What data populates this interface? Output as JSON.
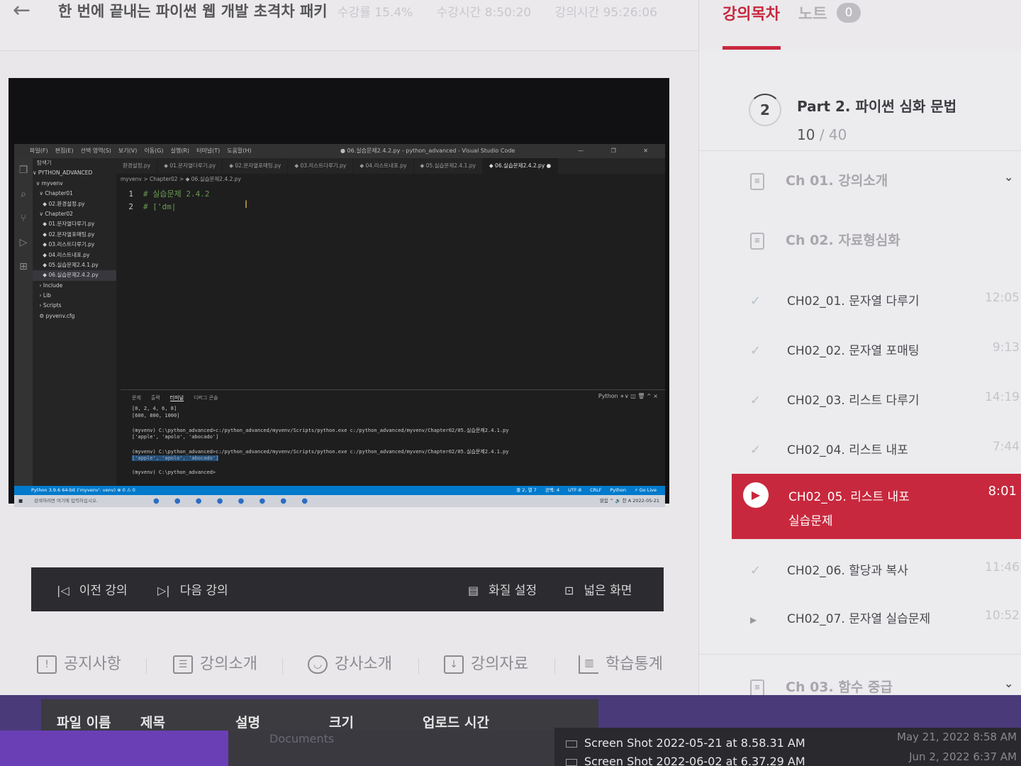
{
  "header": {
    "back_icon": "arrow-left-icon",
    "course_title": "한 번에 끝내는 파이썬 웹 개발 초격차 패키",
    "progress_label": "수강률 15.4%",
    "watched_time": "수강시간 8:50:20",
    "total_time": "강의시간 95:26:06"
  },
  "side_tabs": {
    "toc": "강의목차",
    "note": "노트",
    "note_count": "0"
  },
  "vscode": {
    "window_title": "● 06.실습문제2.4.2.py - python_advanced - Visual Studio Code",
    "menu": [
      "파일(F)",
      "편집(E)",
      "선택 영역(S)",
      "보기(V)",
      "이동(G)",
      "실행(R)",
      "터미널(T)",
      "도움말(H)"
    ],
    "explorer_header": "탐색기",
    "tree": [
      "∨ PYTHON_ADVANCED",
      "  ∨ myvenv",
      "    ∨ Chapter01",
      "      ◆ 02.환경설정.py",
      "    ∨ Chapter02",
      "      ◆ 01.문자열다루기.py",
      "      ◆ 02.문자열포매팅.py",
      "      ◆ 03.리스트다루기.py",
      "      ◆ 04.리스트내포.py",
      "      ◆ 05.실습문제2.4.1.py",
      "      ◆ 06.실습문제2.4.2.py",
      "    › Include",
      "    › Lib",
      "    › Scripts",
      "    ⚙ pyvenv.cfg"
    ],
    "selected_tree_index": 10,
    "tabs": [
      "환경설정.py",
      "◆ 01.문자열다루기.py",
      "◆ 02.문자열포매팅.py",
      "◆ 03.리스트다루기.py",
      "◆ 04.리스트내포.py",
      "◆ 05.실습문제2.4.1.py",
      "◆ 06.실습문제2.4.2.py ●"
    ],
    "active_tab_index": 6,
    "breadcrumb": "myvenv > Chapter02 > ◆ 06.실습문제2.4.2.py",
    "code": [
      {
        "num": "1",
        "text": "# 실습문제 2.4.2"
      },
      {
        "num": "2",
        "text": "# ['dm|"
      }
    ],
    "panel_tabs": [
      "문제",
      "출력",
      "터미널",
      "디버그 콘솔"
    ],
    "active_panel_tab": 2,
    "panel_tools": "Python  +∨  ◫  🗑  ^  ×",
    "terminal": [
      "[0, 2, 4, 6, 8]",
      "[600, 800, 1000]",
      "",
      "(myvenv) C:\\python_advanced>c:/python_advanced/myvenv/Scripts/python.exe c:/python_advanced/myvenv/Chapter02/05.실습문제2.4.1.py",
      "['apple', 'apolo', 'abocado']",
      "",
      "(myvenv) C:\\python_advanced>c:/python_advanced/myvenv/Scripts/python.exe c:/python_advanced/myvenv/Chapter02/05.실습문제2.4.1.py",
      "['apple', 'apolo', 'abocado']",
      "",
      "(myvenv) C:\\python_advanced>"
    ],
    "status_left": "Python 3.9.6 64-bit ('myvenv': venv)   ⊗ 0 ⚠ 0",
    "status_right": [
      "줄 2, 열 7",
      "공백: 4",
      "UTF-8",
      "CRLF",
      "Python",
      "⚡ Go Live"
    ],
    "taskbar_search": "검색하려면 여기에 입력하십시오.",
    "taskbar_tray": "맑음 ^ 🔊 한 A  2022-05-21"
  },
  "player": {
    "prev_icon": "skip-previous-icon",
    "prev_label": "이전 강의",
    "next_icon": "skip-next-icon",
    "next_label": "다음 강의",
    "quality_icon": "quality-icon",
    "quality_label": "화질 설정",
    "wide_icon": "wide-screen-icon",
    "wide_label": "넓은 화면"
  },
  "info_tabs": [
    {
      "label": "공지사항",
      "icon": "notice-icon"
    },
    {
      "label": "강의소개",
      "icon": "clipboard-icon"
    },
    {
      "label": "강사소개",
      "icon": "instructor-icon"
    },
    {
      "label": "강의자료",
      "icon": "download-icon"
    },
    {
      "label": "학습통계",
      "icon": "stats-icon"
    }
  ],
  "sidebar": {
    "part_number": "2",
    "part_title": "Part 2. 파이썬 심화 문법",
    "progress_done": "10",
    "progress_sep": "/",
    "progress_total": "40",
    "chapters": [
      {
        "title": "Ch 01. 강의소개",
        "chevron": "⌄"
      },
      {
        "title": "Ch 02. 자료형심화",
        "chevron": ""
      }
    ],
    "lessons": [
      {
        "title": "CH02_01. 문자열 다루기",
        "time": "12:05",
        "status": "done"
      },
      {
        "title": "CH02_02. 문자열 포매팅",
        "time": "9:13",
        "status": "done"
      },
      {
        "title": "CH02_03. 리스트 다루기",
        "time": "14:19",
        "status": "done"
      },
      {
        "title": "CH02_04. 리스트 내포",
        "time": "7:44",
        "status": "done"
      }
    ],
    "active_lesson": {
      "line1": "CH02_05. 리스트 내포",
      "line2": "실습문제",
      "time": "8:01"
    },
    "more_lessons": [
      {
        "title": "CH02_06. 할당과 복사",
        "time": "11:46",
        "status": "done"
      },
      {
        "title": "CH02_07. 문자열 실습문제",
        "time": "10:52",
        "status": "pending"
      }
    ],
    "next_chapter": "Ch 03. 함수 중급"
  },
  "file_table": {
    "headers": [
      "파일 이름",
      "제목",
      "설명",
      "크기",
      "업로드 시간"
    ]
  },
  "finder": {
    "sidebar_item": "Documents",
    "rows": [
      {
        "name": "Screen Shot 2022-05-21 at 8.58.31 AM",
        "date": "May 21, 2022 8:58 AM"
      },
      {
        "name": "Screen Shot 2022-06-02 at 6.37.29 AM",
        "date": "Jun 2, 2022 6:37 AM"
      }
    ]
  }
}
